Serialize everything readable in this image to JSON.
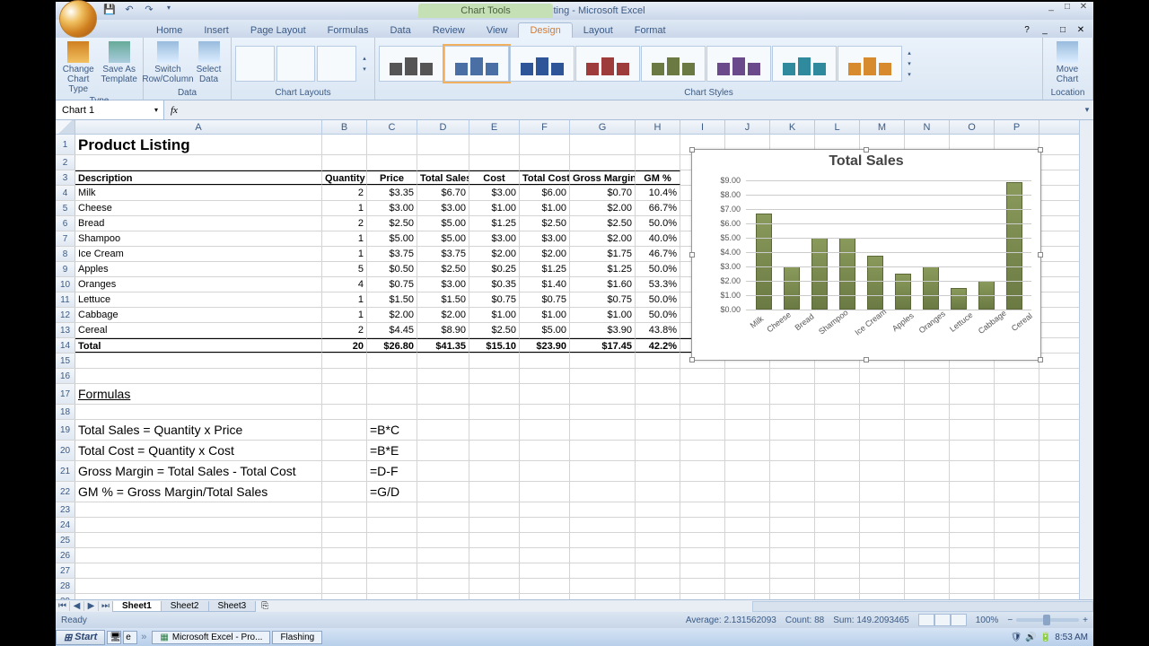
{
  "window": {
    "title": "Product Listing - Microsoft Excel",
    "context_tab": "Chart Tools"
  },
  "tabs": [
    "Home",
    "Insert",
    "Page Layout",
    "Formulas",
    "Data",
    "Review",
    "View",
    "Design",
    "Layout",
    "Format"
  ],
  "active_tab": "Design",
  "ribbon": {
    "type_group": "Type",
    "change_chart": "Change Chart Type",
    "save_as": "Save As Template",
    "data_group": "Data",
    "switch": "Switch Row/Column",
    "select": "Select Data",
    "layouts_group": "Chart Layouts",
    "styles_group": "Chart Styles",
    "location_group": "Location",
    "move_chart": "Move Chart"
  },
  "namebox": "Chart 1",
  "sheet": {
    "title": "Product Listing",
    "headers": [
      "Description",
      "Quantity",
      "Price",
      "Total Sales",
      "Cost",
      "Total Cost",
      "Gross Margin",
      "GM %"
    ],
    "rows": [
      {
        "desc": "Milk",
        "qty": "2",
        "price": "$3.35",
        "sales": "$6.70",
        "cost": "$3.00",
        "tcost": "$6.00",
        "gm": "$0.70",
        "gmp": "10.4%"
      },
      {
        "desc": "Cheese",
        "qty": "1",
        "price": "$3.00",
        "sales": "$3.00",
        "cost": "$1.00",
        "tcost": "$1.00",
        "gm": "$2.00",
        "gmp": "66.7%"
      },
      {
        "desc": "Bread",
        "qty": "2",
        "price": "$2.50",
        "sales": "$5.00",
        "cost": "$1.25",
        "tcost": "$2.50",
        "gm": "$2.50",
        "gmp": "50.0%"
      },
      {
        "desc": "Shampoo",
        "qty": "1",
        "price": "$5.00",
        "sales": "$5.00",
        "cost": "$3.00",
        "tcost": "$3.00",
        "gm": "$2.00",
        "gmp": "40.0%"
      },
      {
        "desc": "Ice Cream",
        "qty": "1",
        "price": "$3.75",
        "sales": "$3.75",
        "cost": "$2.00",
        "tcost": "$2.00",
        "gm": "$1.75",
        "gmp": "46.7%"
      },
      {
        "desc": "Apples",
        "qty": "5",
        "price": "$0.50",
        "sales": "$2.50",
        "cost": "$0.25",
        "tcost": "$1.25",
        "gm": "$1.25",
        "gmp": "50.0%"
      },
      {
        "desc": "Oranges",
        "qty": "4",
        "price": "$0.75",
        "sales": "$3.00",
        "cost": "$0.35",
        "tcost": "$1.40",
        "gm": "$1.60",
        "gmp": "53.3%"
      },
      {
        "desc": "Lettuce",
        "qty": "1",
        "price": "$1.50",
        "sales": "$1.50",
        "cost": "$0.75",
        "tcost": "$0.75",
        "gm": "$0.75",
        "gmp": "50.0%"
      },
      {
        "desc": "Cabbage",
        "qty": "1",
        "price": "$2.00",
        "sales": "$2.00",
        "cost": "$1.00",
        "tcost": "$1.00",
        "gm": "$1.00",
        "gmp": "50.0%"
      },
      {
        "desc": "Cereal",
        "qty": "2",
        "price": "$4.45",
        "sales": "$8.90",
        "cost": "$2.50",
        "tcost": "$5.00",
        "gm": "$3.90",
        "gmp": "43.8%"
      }
    ],
    "total": {
      "desc": "Total",
      "qty": "20",
      "price": "$26.80",
      "sales": "$41.35",
      "cost": "$15.10",
      "tcost": "$23.90",
      "gm": "$17.45",
      "gmp": "42.2%"
    },
    "formulas_hdr": "Formulas",
    "formulas": [
      {
        "label": "Total Sales = Quantity x Price",
        "f": "=B*C"
      },
      {
        "label": "Total Cost = Quantity x Cost",
        "f": "=B*E"
      },
      {
        "label": "Gross Margin = Total Sales - Total Cost",
        "f": "=D-F"
      },
      {
        "label": "GM % = Gross Margin/Total Sales",
        "f": "=G/D"
      }
    ]
  },
  "chart_data": {
    "type": "bar",
    "title": "Total Sales",
    "categories": [
      "Milk",
      "Cheese",
      "Bread",
      "Shampoo",
      "Ice Cream",
      "Apples",
      "Oranges",
      "Lettuce",
      "Cabbage",
      "Cereal"
    ],
    "values": [
      6.7,
      3.0,
      5.0,
      5.0,
      3.75,
      2.5,
      3.0,
      1.5,
      2.0,
      8.9
    ],
    "ylim": [
      0,
      9
    ],
    "yticks": [
      "$0.00",
      "$1.00",
      "$2.00",
      "$3.00",
      "$4.00",
      "$5.00",
      "$6.00",
      "$7.00",
      "$8.00",
      "$9.00"
    ]
  },
  "sheet_tabs": [
    "Sheet1",
    "Sheet2",
    "Sheet3"
  ],
  "active_sheet": "Sheet1",
  "statusbar": {
    "ready": "Ready",
    "avg": "Average: 2.131562093",
    "count": "Count: 88",
    "sum": "Sum: 149.2093465",
    "zoom": "100%"
  },
  "taskbar": {
    "start": "Start",
    "items": [
      "Microsoft Excel - Pro...",
      "Flashing"
    ],
    "time": "8:53 AM"
  },
  "colheads": [
    "A",
    "B",
    "C",
    "D",
    "E",
    "F",
    "G",
    "H",
    "I",
    "J",
    "K",
    "L",
    "M",
    "N",
    "O",
    "P"
  ]
}
